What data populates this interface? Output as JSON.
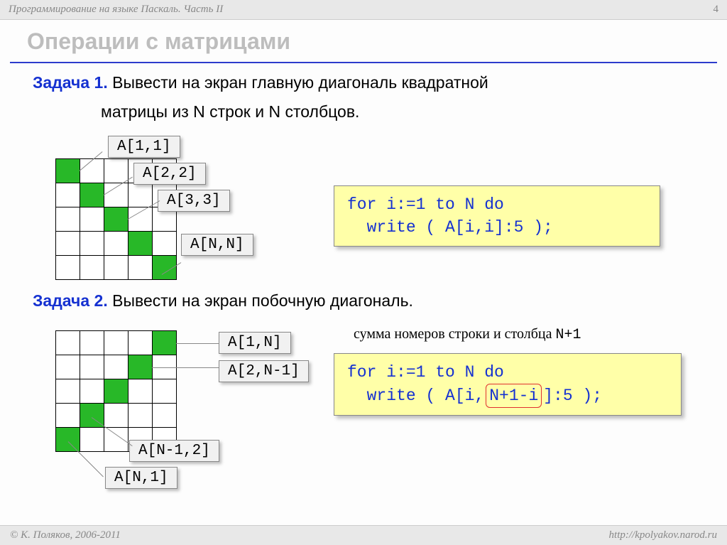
{
  "header": {
    "title": "Программирование на языке Паскаль. Часть II",
    "pagenum": "4"
  },
  "title": "Операции с матрицами",
  "task1": {
    "label": "Задача 1.",
    "text1": " Вывести на экран главную диагональ квадратной",
    "text2": "матрицы из N строк и N столбцов.",
    "labels": {
      "a11": "A[1,1]",
      "a22": "A[2,2]",
      "a33": "A[3,3]",
      "ann": "A[N,N]"
    },
    "code": "for i:=1 to N do\n  write ( A[i,i]:5 );"
  },
  "task2": {
    "label": "Задача 2.",
    "text": " Вывести на экран побочную диагональ.",
    "hint_pre": "сумма номеров строки и столбца ",
    "hint_mono": "N+1",
    "labels": {
      "a1n": "A[1,N]",
      "a2n1": "A[2,N-1]",
      "an12": "A[N-1,2]",
      "an1": "A[N,1]"
    },
    "code_pre": "for i:=1 to N do\n  write ( A[i,",
    "code_hl": "N+1-i",
    "code_post": "]:5 );"
  },
  "footer": {
    "copyright": "© К. Поляков, 2006-2011",
    "url": "http://kpolyakov.narod.ru"
  }
}
